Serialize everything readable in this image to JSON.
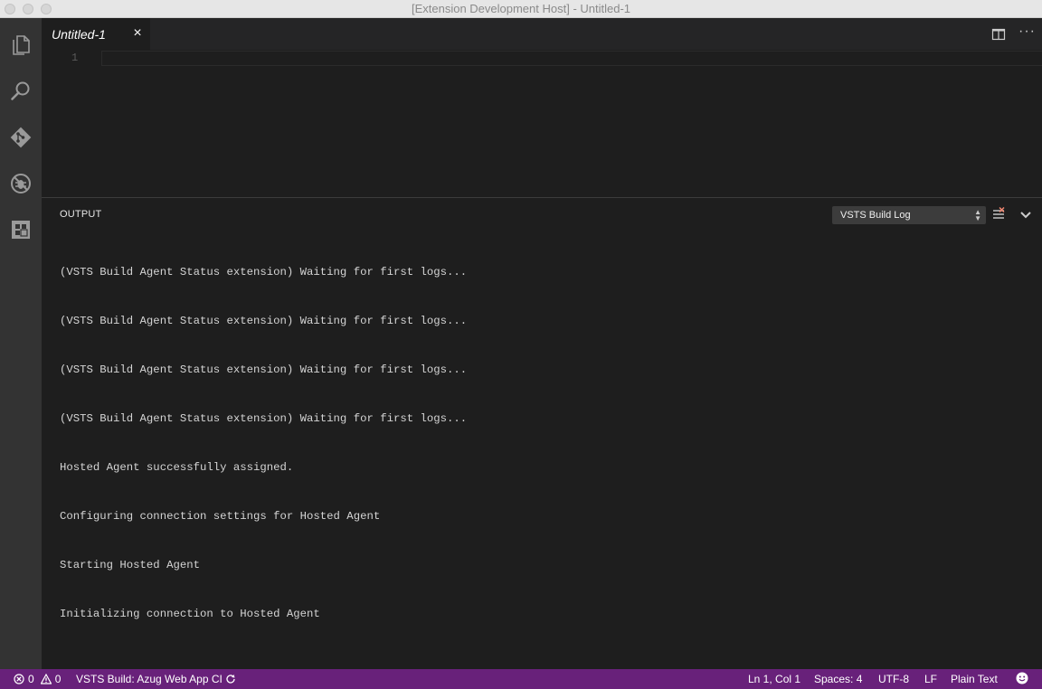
{
  "window": {
    "title": "[Extension Development Host] - Untitled-1"
  },
  "activity_bar": {
    "items": [
      {
        "name": "explorer",
        "icon": "files-icon"
      },
      {
        "name": "search",
        "icon": "search-icon"
      },
      {
        "name": "source-control",
        "icon": "git-icon"
      },
      {
        "name": "debug",
        "icon": "debug-icon"
      },
      {
        "name": "extensions",
        "icon": "extensions-icon"
      }
    ]
  },
  "editor": {
    "tab": {
      "label": "Untitled-1",
      "close_glyph": "×"
    },
    "line_numbers": [
      "1"
    ]
  },
  "panel": {
    "title": "OUTPUT",
    "channel": "VSTS Build Log",
    "log_lines": [
      "(VSTS Build Agent Status extension) Waiting for first logs...",
      "(VSTS Build Agent Status extension) Waiting for first logs...",
      "(VSTS Build Agent Status extension) Waiting for first logs...",
      "(VSTS Build Agent Status extension) Waiting for first logs...",
      "Hosted Agent successfully assigned.",
      "Configuring connection settings for Hosted Agent",
      "Starting Hosted Agent",
      "Initializing connection to Hosted Agent"
    ]
  },
  "status_bar": {
    "color": "#68217a",
    "errors": "0",
    "warnings": "0",
    "build": "VSTS Build: Azug Web App CI",
    "position": "Ln 1, Col 1",
    "indent": "Spaces: 4",
    "encoding": "UTF-8",
    "eol": "LF",
    "language": "Plain Text"
  }
}
